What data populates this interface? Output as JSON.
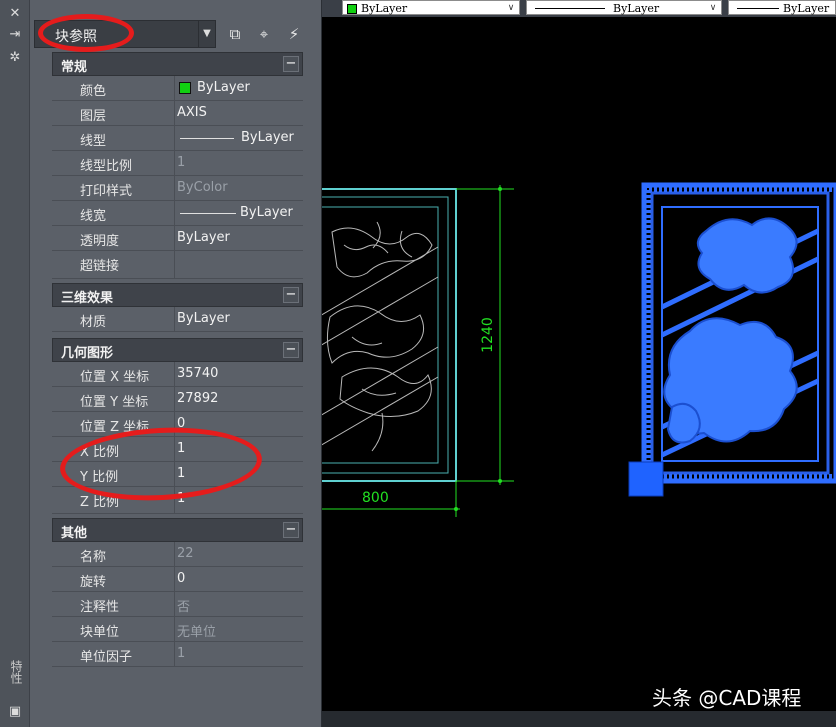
{
  "toolbar": {
    "color_combo": "ByLayer",
    "linetype_combo": "ByLayer",
    "lineweight_combo": "ByLayer"
  },
  "palette": {
    "title": "特性",
    "selection": "块参照",
    "sections": [
      {
        "title": "常规",
        "rows": [
          {
            "label": "颜色",
            "value": "ByLayer"
          },
          {
            "label": "图层",
            "value": "AXIS"
          },
          {
            "label": "线型",
            "value": "ByLayer"
          },
          {
            "label": "线型比例",
            "value": "1"
          },
          {
            "label": "打印样式",
            "value": "ByColor"
          },
          {
            "label": "线宽",
            "value": "ByLayer"
          },
          {
            "label": "透明度",
            "value": "ByLayer"
          },
          {
            "label": "超链接",
            "value": ""
          }
        ]
      },
      {
        "title": "三维效果",
        "rows": [
          {
            "label": "材质",
            "value": "ByLayer"
          }
        ]
      },
      {
        "title": "几何图形",
        "rows": [
          {
            "label": "位置 X 坐标",
            "value": "35740"
          },
          {
            "label": "位置 Y 坐标",
            "value": "27892"
          },
          {
            "label": "位置 Z 坐标",
            "value": "0"
          },
          {
            "label": "X 比例",
            "value": "1"
          },
          {
            "label": "Y 比例",
            "value": "1"
          },
          {
            "label": "Z 比例",
            "value": "1"
          }
        ]
      },
      {
        "title": "其他",
        "rows": [
          {
            "label": "名称",
            "value": "22"
          },
          {
            "label": "旋转",
            "value": "0"
          },
          {
            "label": "注释性",
            "value": "否"
          },
          {
            "label": "块单位",
            "value": "无单位"
          },
          {
            "label": "单位因子",
            "value": "1"
          }
        ]
      }
    ]
  },
  "drawing": {
    "dim_height": "1240",
    "dim_width": "800"
  },
  "watermark": "头条 @CAD课程",
  "colors": {
    "dimension": "#22e022",
    "selected_block": "#1f63ff",
    "block_frame": "#5fd0d0",
    "annotation": "#e51c1c"
  }
}
